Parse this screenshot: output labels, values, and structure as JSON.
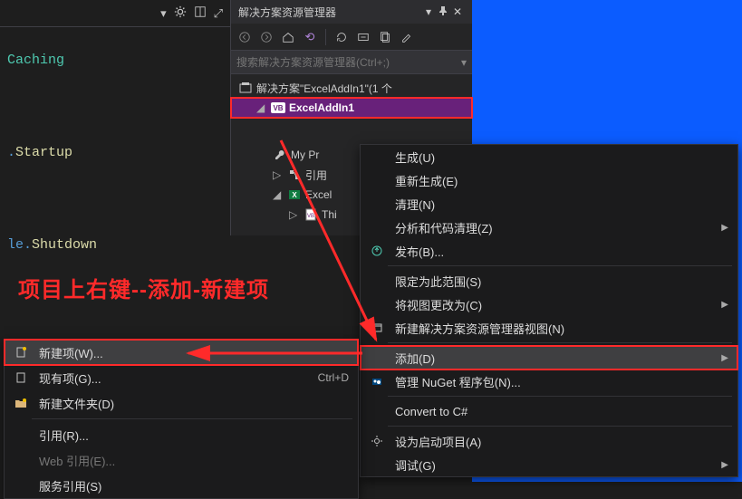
{
  "code": {
    "line1_type": "Caching",
    "line2_this": ".",
    "line2_mem": "Startup",
    "line3_this": "le.",
    "line3_mem": "Shutdown"
  },
  "solution_explorer": {
    "title": "解决方案资源管理器",
    "search_placeholder": "搜索解决方案资源管理器(Ctrl+;)",
    "solution_label": "解决方案\"ExcelAddIn1\"(1 个",
    "project": "ExcelAddIn1",
    "nodes": {
      "my_project": "My Pr",
      "references": "引用",
      "excel": "Excel",
      "this": "Thi"
    }
  },
  "context_main": {
    "build": "生成(U)",
    "rebuild": "重新生成(E)",
    "clean": "清理(N)",
    "analyze": "分析和代码清理(Z)",
    "publish": "发布(B)...",
    "scope": "限定为此范围(S)",
    "change_view": "将视图更改为(C)",
    "new_se_view": "新建解决方案资源管理器视图(N)",
    "add": "添加(D)",
    "nuget": "管理 NuGet 程序包(N)...",
    "convert": "Convert to C#",
    "startup": "设为启动项目(A)",
    "debug": "调试(G)"
  },
  "context_add": {
    "new_item": "新建项(W)...",
    "existing_item": "现有项(G)...",
    "existing_shortcut": "Ctrl+D",
    "new_folder": "新建文件夹(D)",
    "reference": "引用(R)...",
    "web_ref": "Web 引用(E)...",
    "service_ref": "服务引用(S)"
  },
  "annotation": "项目上右键--添加-新建项"
}
